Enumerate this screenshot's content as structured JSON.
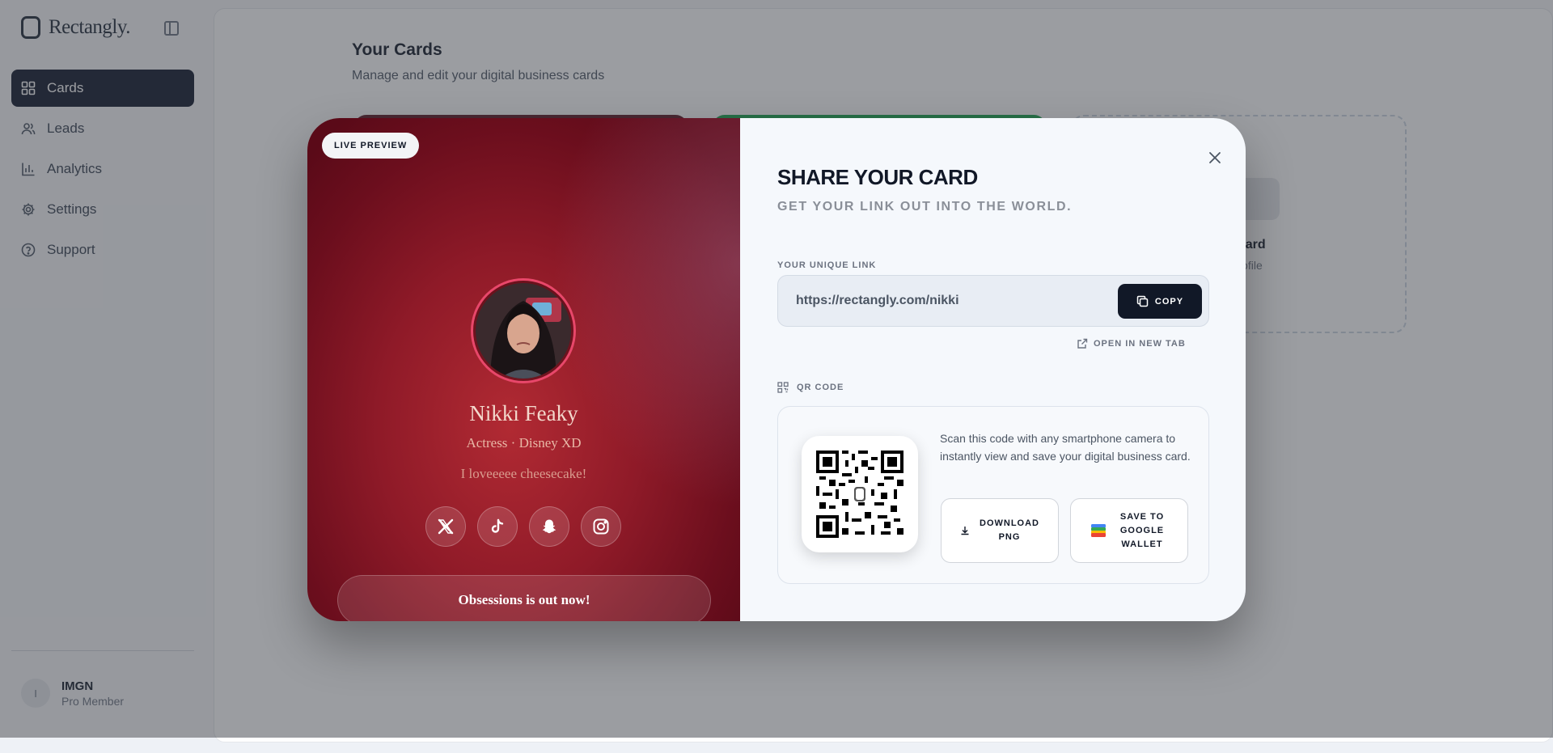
{
  "app": {
    "brand": "Rectangly.",
    "nav": [
      {
        "label": "Cards",
        "icon": "cards-icon",
        "active": true
      },
      {
        "label": "Leads",
        "icon": "users-icon",
        "active": false
      },
      {
        "label": "Analytics",
        "icon": "bar-chart-icon",
        "active": false
      },
      {
        "label": "Settings",
        "icon": "gear-icon",
        "active": false
      },
      {
        "label": "Support",
        "icon": "help-circle-icon",
        "active": false
      }
    ],
    "user": {
      "initial": "I",
      "name": "IMGN",
      "plan": "Pro Member"
    }
  },
  "page": {
    "title": "Your Cards",
    "subtitle": "Manage and edit your digital business cards",
    "new_card_title": "ew Card",
    "new_card_subtitle": "er profile"
  },
  "preview": {
    "badge": "LIVE PREVIEW",
    "name": "Nikki Feaky",
    "role": "Actress · Disney XD",
    "bio": "I loveeeee cheesecake!",
    "socials": [
      "x-icon",
      "tiktok-icon",
      "snapchat-icon",
      "instagram-icon"
    ],
    "cta": "Obsessions is out now!",
    "accent": "#8f1a28"
  },
  "share": {
    "title": "SHARE YOUR CARD",
    "subtitle": "GET YOUR LINK OUT INTO THE WORLD.",
    "link_label": "YOUR UNIQUE LINK",
    "link": "https://rectangly.com/nikki",
    "copy": "COPY",
    "open_new_tab": "OPEN IN NEW TAB",
    "qr_label": "QR CODE",
    "qr_description": "Scan this code with any smartphone camera to instantly view and save your digital business card.",
    "download": "DOWNLOAD PNG",
    "wallet": "SAVE TO GOOGLE WALLET"
  }
}
